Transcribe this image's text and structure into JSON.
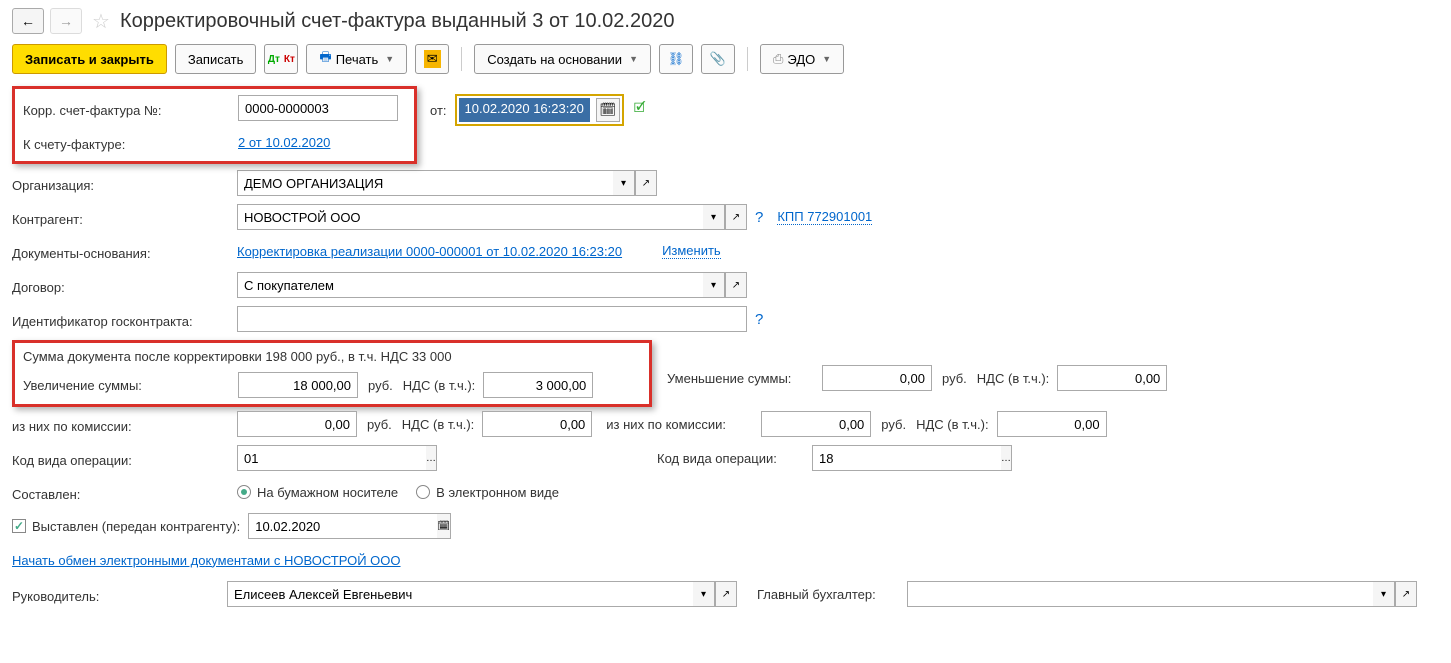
{
  "title": "Корректировочный счет-фактура выданный 3 от 10.02.2020",
  "toolbar": {
    "save_close": "Записать и закрыть",
    "save": "Записать",
    "print": "Печать",
    "create_based": "Создать на основании",
    "edo": "ЭДО"
  },
  "fields": {
    "korr_number_label": "Корр. счет-фактура №:",
    "korr_number": "0000-0000003",
    "date_label": "от:",
    "date_value": "10.02.2020 16:23:20",
    "to_invoice_label": "К счету-фактуре:",
    "to_invoice_link": "2 от 10.02.2020",
    "org_label": "Организация:",
    "org_value": "ДЕМО ОРГАНИЗАЦИЯ",
    "counterparty_label": "Контрагент:",
    "counterparty_value": "НОВОСТРОЙ ООО",
    "kpp_link": "КПП 772901001",
    "basis_label": "Документы-основания:",
    "basis_link": "Корректировка реализации 0000-000001 от 10.02.2020 16:23:20",
    "change_link": "Изменить",
    "contract_label": "Договор:",
    "contract_value": "С покупателем",
    "goscontract_label": "Идентификатор госконтракта:",
    "goscontract_value": "",
    "sum_after_label": "Сумма документа после корректировки 198 000 руб., в т.ч. НДС 33 000",
    "increase_label": "Увеличение суммы:",
    "increase_value": "18 000,00",
    "rub": "руб.",
    "nds_label": "НДС (в т.ч.):",
    "increase_nds": "3 000,00",
    "decrease_label": "Уменьшение суммы:",
    "decrease_value": "0,00",
    "decrease_nds": "0,00",
    "commission_label": "из них по комиссии:",
    "commission_inc": "0,00",
    "commission_inc_nds": "0,00",
    "commission_dec": "0,00",
    "commission_dec_nds": "0,00",
    "op_code_label": "Код вида операции:",
    "op_code1": "01",
    "op_code2": "18",
    "composed_label": "Составлен:",
    "paper": "На бумажном носителе",
    "electronic": "В электронном виде",
    "issued_label": "Выставлен (передан контрагенту):",
    "issued_date": "10.02.2020",
    "exchange_link": "Начать обмен электронными документами с НОВОСТРОЙ ООО",
    "manager_label": "Руководитель:",
    "manager_value": "Елисеев Алексей Евгеньевич",
    "chief_acc_label": "Главный бухгалтер:",
    "chief_acc_value": ""
  }
}
